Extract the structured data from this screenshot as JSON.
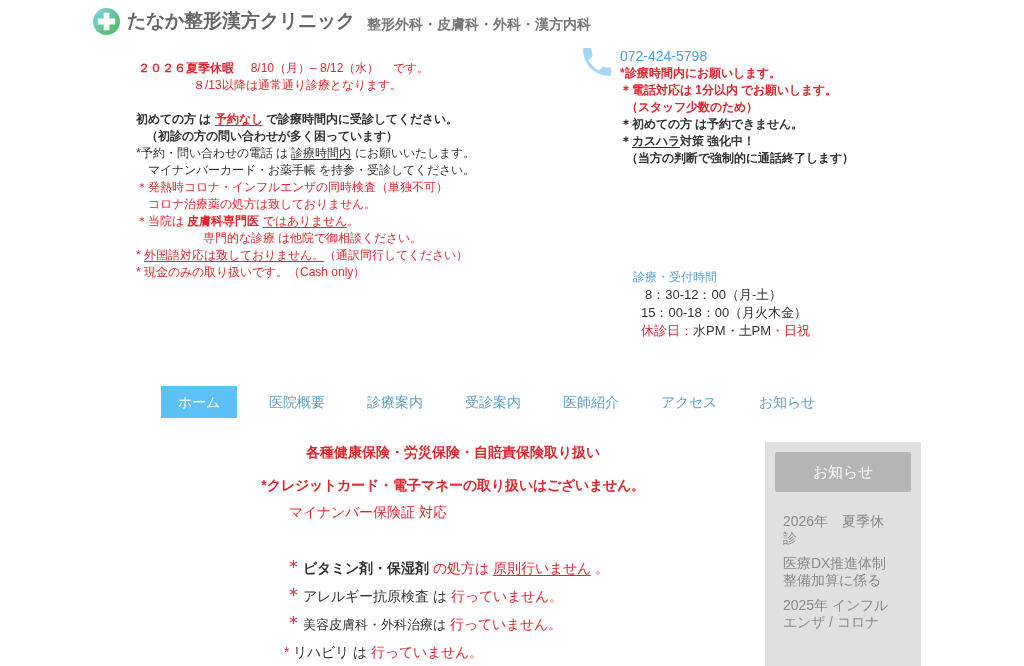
{
  "header": {
    "clinic_name": "たなか整形漢方クリニック",
    "departments": "整形外科・皮膚科・外科・漢方内科"
  },
  "holiday_notice": [
    [
      {
        "text": "２０２６夏季休暇",
        "kind": "alert",
        "bold": true,
        "underline": false
      },
      {
        "text": "     8/10（月）– 8/12（水）    です。",
        "kind": "alert",
        "bold": false,
        "underline": false
      }
    ],
    [
      {
        "text": "８/13以降は通常通り診療となります。",
        "kind": "alert",
        "bold": false,
        "underline": false
      }
    ]
  ],
  "notices": [
    [
      {
        "text": "初めての方 は ",
        "kind": "plain",
        "bold": true,
        "underline": false
      },
      {
        "text": "予約なし",
        "kind": "alert",
        "bold": true,
        "underline": true
      },
      {
        "text": " で診療時間内に受診してください。",
        "kind": "plain",
        "bold": true,
        "underline": false
      }
    ],
    [
      {
        "text": "（初診の方の問い合わせが多く困っています）",
        "kind": "plain",
        "bold": true,
        "underline": false
      }
    ],
    [
      {
        "text": "*予約・問い合わせの電話 は ",
        "kind": "plain",
        "bold": false,
        "underline": false
      },
      {
        "text": "診療時間内",
        "kind": "plain",
        "bold": false,
        "underline": true
      },
      {
        "text": " にお願いいたします。",
        "kind": "plain",
        "bold": false,
        "underline": false
      }
    ],
    [
      {
        "text": "マイナンバーカード・お薬手帳 を持参・受診してください。",
        "kind": "plain",
        "bold": false,
        "underline": false
      }
    ],
    [
      {
        "text": "＊発熱時コロナ・インフルエンザの同時検査（単独不可）",
        "kind": "alert",
        "bold": false,
        "underline": false
      }
    ],
    [
      {
        "text": "コロナ治療薬の処方は致しておりません。",
        "kind": "alert",
        "bold": false,
        "underline": false
      }
    ],
    [
      {
        "text": "＊当院は ",
        "kind": "alert",
        "bold": false,
        "underline": false
      },
      {
        "text": "皮膚科専門医 ",
        "kind": "alert",
        "bold": true,
        "underline": false
      },
      {
        "text": "ではありません",
        "kind": "alert",
        "bold": false,
        "underline": true
      },
      {
        "text": "。",
        "kind": "alert",
        "bold": false,
        "underline": false
      }
    ],
    [
      {
        "text": "専門的な診療 は他院で御相談ください。",
        "kind": "alert",
        "bold": false,
        "underline": false
      }
    ],
    [
      {
        "text": "* ",
        "kind": "alert",
        "bold": false,
        "underline": false
      },
      {
        "text": "外国語対応は致しておりません。",
        "kind": "alert",
        "bold": false,
        "underline": true
      },
      {
        "text": "（通訳同行してください）",
        "kind": "alert",
        "bold": false,
        "underline": false
      }
    ],
    [
      {
        "text": "* 現金のみの取り扱いです。（Cash only）",
        "kind": "alert",
        "bold": false,
        "underline": false
      }
    ]
  ],
  "contact": {
    "phone": "072-424-5798",
    "notes": [
      [
        {
          "text": "*診療時間内にお願いします。",
          "kind": "alert",
          "bold": true,
          "underline": false
        }
      ],
      [
        {
          "text": "＊電話対応は 1分以内 でお願いします。",
          "kind": "alert",
          "bold": true,
          "underline": false
        }
      ],
      [
        {
          "text": "（スタッフ少数のため）",
          "kind": "alert",
          "bold": true,
          "underline": false
        }
      ],
      [
        {
          "text": "＊初めての方 は予約できません。",
          "kind": "plain",
          "bold": true,
          "underline": false
        }
      ],
      [
        {
          "text": "＊",
          "kind": "plain",
          "bold": true,
          "underline": false
        },
        {
          "text": "カスハラ",
          "kind": "plain",
          "bold": true,
          "underline": true
        },
        {
          "text": "対策 強化中！",
          "kind": "plain",
          "bold": true,
          "underline": false
        }
      ],
      [
        {
          "text": "（当方の判断で強制的に通話終了します）",
          "kind": "plain",
          "bold": true,
          "underline": false
        }
      ]
    ]
  },
  "hours": {
    "title": "診療・受付時間",
    "lines": [
      [
        {
          "text": "8：30-12：00（月-土）",
          "kind": "plain",
          "bold": false,
          "underline": false
        }
      ],
      [
        {
          "text": "15：00-18：00（月火木金）",
          "kind": "plain",
          "bold": false,
          "underline": false
        }
      ],
      [
        {
          "text": "休診日：",
          "kind": "alert",
          "bold": false,
          "underline": false
        },
        {
          "text": "水PM・土PM",
          "kind": "plain",
          "bold": false,
          "underline": false
        },
        {
          "text": "・日祝",
          "kind": "alert",
          "bold": false,
          "underline": false
        }
      ]
    ]
  },
  "nav": [
    {
      "label": "ホーム",
      "selected": true
    },
    {
      "label": "医院概要",
      "selected": false
    },
    {
      "label": "診療案内",
      "selected": false
    },
    {
      "label": "受診案内",
      "selected": false
    },
    {
      "label": "医師紹介",
      "selected": false
    },
    {
      "label": "アクセス",
      "selected": false
    },
    {
      "label": "お知らせ",
      "selected": false
    }
  ],
  "main": {
    "headlines": [
      [
        {
          "text": "各種健康保険・労災保険・自賠責保険取り扱い",
          "kind": "alert",
          "bold": true,
          "underline": false
        }
      ],
      [
        {
          "text": "*クレジットカード・電子マネーの取り扱いはございません。",
          "kind": "alert",
          "bold": true,
          "underline": false
        }
      ],
      [
        {
          "text": "マイナンバー保険証 対応",
          "kind": "alert",
          "bold": false,
          "underline": false
        }
      ]
    ],
    "restrictions": [
      [
        {
          "text": "＊",
          "kind": "mark",
          "bold": false,
          "underline": false
        },
        {
          "text": "ビタミン剤・保湿剤",
          "kind": "plain",
          "bold": true,
          "underline": false
        },
        {
          "text": " の処方は ",
          "kind": "alert",
          "bold": false,
          "underline": false
        },
        {
          "text": "原則行いません",
          "kind": "alert",
          "bold": false,
          "underline": true
        },
        {
          "text": " 。",
          "kind": "alert",
          "bold": false,
          "underline": false
        }
      ],
      [
        {
          "text": "＊",
          "kind": "mark",
          "bold": false,
          "underline": false
        },
        {
          "text": "アレルギー抗原検査 は ",
          "kind": "plain",
          "bold": false,
          "underline": false
        },
        {
          "text": "行っていません。",
          "kind": "alert",
          "bold": false,
          "underline": false
        }
      ],
      [
        {
          "text": "＊",
          "kind": "mark",
          "bold": false,
          "underline": false
        },
        {
          "text": "美容皮膚科・外科治療は ",
          "kind": "minor",
          "bold": false,
          "underline": false
        },
        {
          "text": "行っていません。",
          "kind": "alert",
          "bold": false,
          "underline": false
        }
      ],
      [
        {
          "text": "* ",
          "kind": "alert",
          "bold": false,
          "underline": false
        },
        {
          "text": "リハビリ は ",
          "kind": "plain",
          "bold": false,
          "underline": false
        },
        {
          "text": "行っていません。",
          "kind": "alert",
          "bold": false,
          "underline": false
        }
      ]
    ]
  },
  "sidebar": {
    "title": "お知らせ",
    "items": [
      "2026年　夏季休診",
      "医療DX推進体制整備加算に係る",
      "2025年 インフルエンザ / コロナ"
    ]
  }
}
